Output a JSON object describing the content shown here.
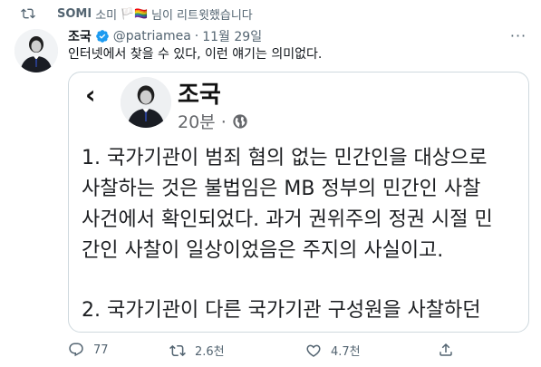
{
  "retweet": {
    "name": "SOMI",
    "name_suffix": "소미",
    "flags": "🏳️🏳️‍🌈",
    "suffix": "님이 리트윗했습니다"
  },
  "tweet": {
    "author": "조국",
    "handle": "@patriamea",
    "separator": "·",
    "date": "11월 29일",
    "text": "인터넷에서 찾을 수 있다, 이런 얘기는 의미없다.",
    "more_label": "···"
  },
  "media": {
    "back_label": "‹",
    "name": "조국",
    "time": "20분 ·",
    "body_lines": [
      "1. 국가기관이 범죄 혐의 없는 민간인을 대상으로",
      "사찰하는 것은 불법임은 MB 정부의 민간인 사찰",
      "사건에서 확인되었다. 과거 권위주의 정권 시절 민",
      "간인 사찰이 일상이었음은 주지의 사실이고.",
      "",
      "2. 국가기관이 다른 국가기관 구성원을 사찰하던"
    ]
  },
  "actions": {
    "reply_count": "77",
    "retweet_count": "2.6천",
    "like_count": "4.7천"
  },
  "colors": {
    "verified": "#1d9bf0",
    "muted": "#536471",
    "border": "#cfd9de"
  }
}
